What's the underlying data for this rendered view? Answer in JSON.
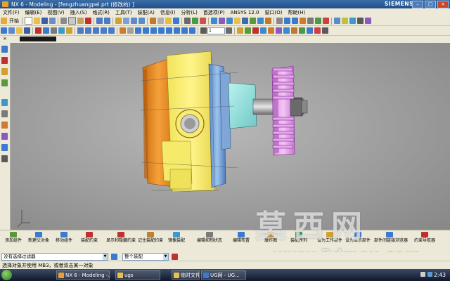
{
  "window": {
    "title": "NX 6 - Modeling - [fengzhuangpei.prt  (修改的) ]",
    "brand": "SIEMENS"
  },
  "menu": [
    "文件(F)",
    "编辑(E)",
    "视图(V)",
    "插入(S)",
    "格式(R)",
    "工具(T)",
    "装配(A)",
    "信息(I)",
    "分析(L)",
    "首选项(P)",
    "ANSYS 12.0",
    "窗口(O)",
    "帮助(H)"
  ],
  "toolbar": {
    "start_label": "开始",
    "layer_value": "1"
  },
  "assembly_toolbar": [
    {
      "label": "添加组件",
      "color": "#5a9a3a"
    },
    {
      "label": "新建父对象",
      "color": "#3a7ad0"
    },
    {
      "label": "移动组件",
      "color": "#3a7ad0"
    },
    {
      "label": "装配约束",
      "color": "#c03030"
    },
    {
      "label": "显示和隐藏约束",
      "color": "#c03030"
    },
    {
      "label": "记住装配约束",
      "color": "#c08030"
    },
    {
      "label": "镜像装配",
      "color": "#3a9ad0"
    },
    {
      "label": "编辑抑制状态",
      "color": "#7a7a7a"
    },
    {
      "label": "编辑布置",
      "color": "#3a7ad0"
    },
    {
      "label": "爆炸图",
      "color": "#d09030"
    },
    {
      "label": "装配序列",
      "color": "#3a9a5a"
    },
    {
      "label": "设为工作部件",
      "color": "#d0a030"
    },
    {
      "label": "设为显示部件",
      "color": "#3a7ad0"
    },
    {
      "label": "部件间链接浏览器",
      "color": "#3a7ad0"
    },
    {
      "label": "约束导航器",
      "color": "#c03030"
    }
  ],
  "selection": {
    "filter_value": "没有选择过滤器",
    "scope_value": "整个装配"
  },
  "status": "选择对象并使用 MB3，或者双击某一对象",
  "watermark": {
    "cn": "莫西网",
    "url": "www.3dmox.com"
  },
  "taskbar": {
    "tasks": [
      "NX 6 - Modeling -...",
      "ugs",
      "临时文件",
      "UG网 - UG..."
    ],
    "time": "2:43"
  }
}
